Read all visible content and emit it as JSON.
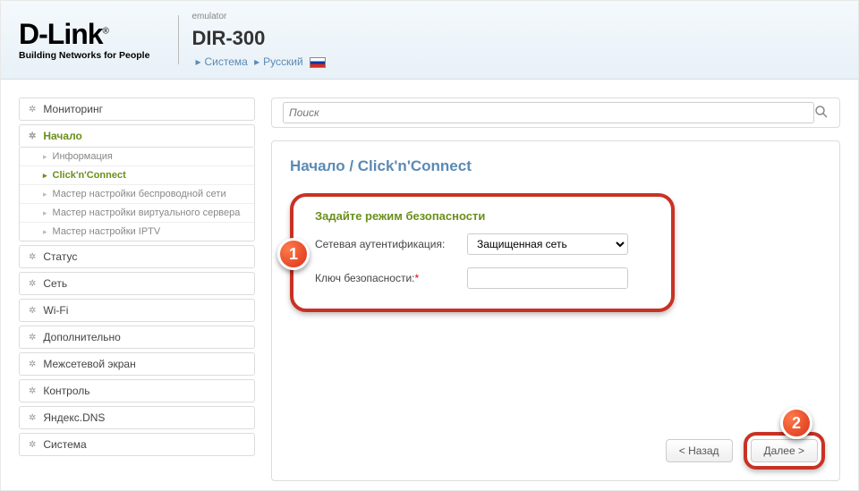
{
  "header": {
    "logo_main": "D-Link",
    "logo_sub": "Building Networks for People",
    "emu": "emulator",
    "model": "DIR-300",
    "crumb1": "Система",
    "crumb2": "Русский"
  },
  "sidebar": {
    "groups": [
      "Мониторинг",
      "Начало",
      "Статус",
      "Сеть",
      "Wi-Fi",
      "Дополнительно",
      "Межсетевой экран",
      "Контроль",
      "Яндекс.DNS",
      "Система"
    ],
    "sub_items": [
      "Информация",
      "Click'n'Connect",
      "Мастер настройки беспроводной сети",
      "Мастер настройки виртуального сервера",
      "Мастер настройки IPTV"
    ]
  },
  "search": {
    "placeholder": "Поиск"
  },
  "page": {
    "title": "Начало /  Click'n'Connect",
    "section_title": "Задайте режим безопасности",
    "auth_label": "Сетевая аутентификация:",
    "auth_value": "Защищенная сеть",
    "key_label": "Ключ безопасности:",
    "key_req": "*",
    "back_btn": "< Назад",
    "next_btn": "Далее >"
  },
  "markers": {
    "one": "1",
    "two": "2"
  }
}
